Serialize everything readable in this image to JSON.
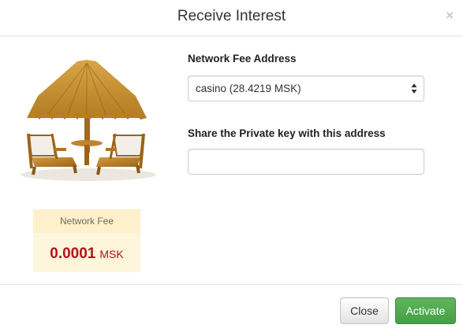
{
  "modal": {
    "title": "Receive Interest",
    "close_symbol": "×"
  },
  "illustration": {
    "icon": "beach-umbrella-chairs-icon"
  },
  "fee": {
    "label": "Network Fee",
    "amount": "0.0001",
    "unit": "MSK"
  },
  "form": {
    "address_label": "Network Fee Address",
    "address_selected": "casino (28.4219 MSK)",
    "key_label": "Share the Private key with this address",
    "key_value": ""
  },
  "footer": {
    "close_label": "Close",
    "activate_label": "Activate"
  },
  "colors": {
    "fee_text": "#b3141c",
    "fee_bg": "#fdf5dc",
    "activate_bg": "#4cae4c"
  }
}
